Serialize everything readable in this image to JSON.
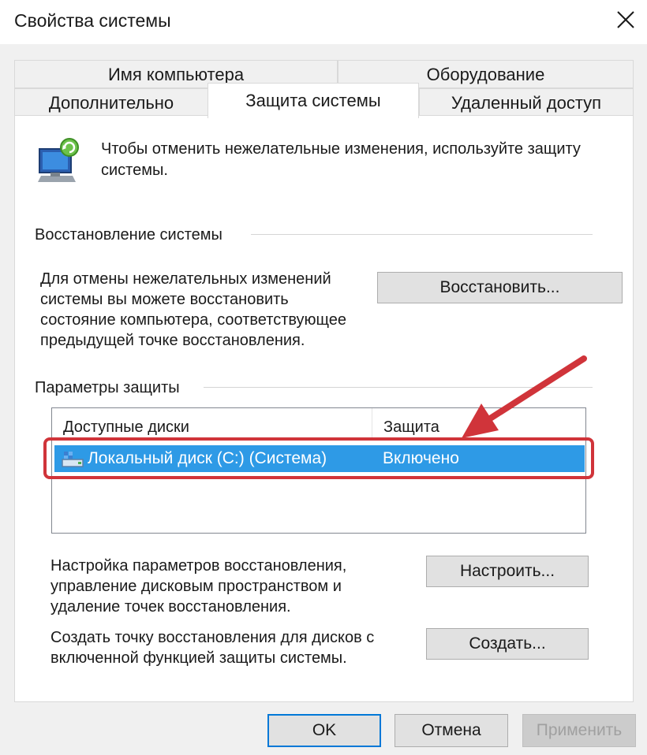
{
  "window": {
    "title": "Свойства системы"
  },
  "tabs": {
    "row1": [
      "Имя компьютера",
      "Оборудование"
    ],
    "row2": [
      "Дополнительно",
      "Защита системы",
      "Удаленный доступ"
    ],
    "active": "Защита системы"
  },
  "intro": "Чтобы отменить нежелательные изменения, используйте защиту системы.",
  "restore": {
    "group_label": "Восстановление системы",
    "description": "Для отмены нежелательных изменений системы вы можете восстановить состояние компьютера, соответствующее предыдущей точке восстановления.",
    "button": "Восстановить..."
  },
  "protection": {
    "group_label": "Параметры защиты",
    "columns": [
      "Доступные диски",
      "Защита"
    ],
    "rows": [
      {
        "disk": "Локальный диск (C:) (Система)",
        "protection": "Включено",
        "selected": true
      }
    ],
    "configure_text": "Настройка параметров восстановления, управление дисковым пространством и удаление точек восстановления.",
    "configure_button": "Настроить...",
    "create_text": "Создать точку восстановления для дисков с включенной функцией защиты системы.",
    "create_button": "Создать..."
  },
  "footer": {
    "ok": "OK",
    "cancel": "Отмена",
    "apply": "Применить"
  },
  "colors": {
    "selection": "#2e9ae6",
    "annotation": "#d0343a",
    "focus_border": "#0078d7"
  },
  "icons": [
    "close-icon",
    "system-protection-icon",
    "local-disk-icon",
    "annotation-arrow"
  ]
}
